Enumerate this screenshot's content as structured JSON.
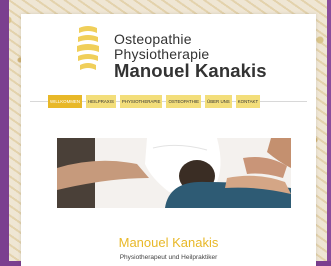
{
  "brand": {
    "line1": "Osteopathie",
    "line2": "Physiotherapie",
    "line3": "Manouel Kanakis"
  },
  "nav": {
    "items": [
      "WILLKOMMEN",
      "HEILPRAXIS",
      "PHYSIOTHERAPIE",
      "OSTEOPATHIE",
      "ÜBER UNS",
      "KONTAKT"
    ],
    "active_index": 0
  },
  "hero": {
    "title": "Manouel Kanakis",
    "subtitle": "Physiotherapeut und Heilpraktiker"
  },
  "colors": {
    "accent": "#e8b828",
    "nav_bg": "#f3de7a",
    "frame": "#7b3f8f",
    "text": "#333333"
  }
}
